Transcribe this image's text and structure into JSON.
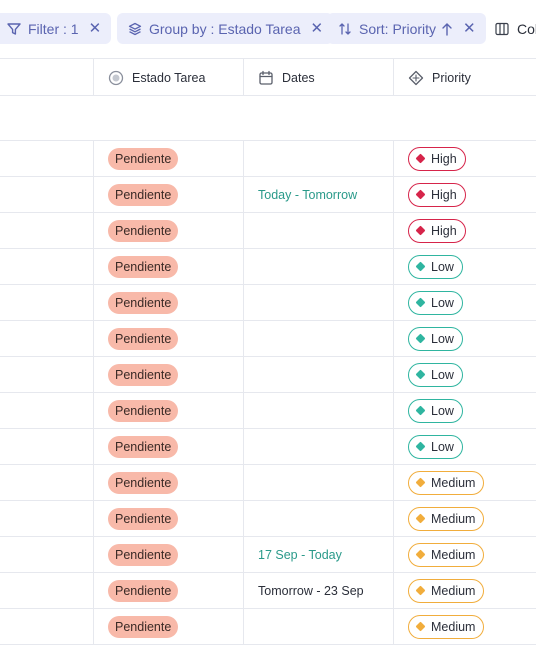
{
  "toolbar": {
    "filter_label": "Filter : 1",
    "group_label": "Group by : Estado Tarea",
    "sort_label": "Sort: Priority",
    "columns_label": "Col"
  },
  "columns": {
    "estado": "Estado Tarea",
    "dates": "Dates",
    "priority": "Priority"
  },
  "colors": {
    "high": "#d6244a",
    "low": "#2fb5a0",
    "medium": "#f1ad3c",
    "status_bg": "#f8b9a9",
    "chip_bg": "#eceefb"
  },
  "rows": [
    {
      "status": "Pendiente",
      "dates": "",
      "dates_style": "teal",
      "priority": "High",
      "level": "high"
    },
    {
      "status": "Pendiente",
      "dates": "Today - Tomorrow",
      "dates_style": "teal",
      "priority": "High",
      "level": "high"
    },
    {
      "status": "Pendiente",
      "dates": "",
      "dates_style": "teal",
      "priority": "High",
      "level": "high"
    },
    {
      "status": "Pendiente",
      "dates": "",
      "dates_style": "teal",
      "priority": "Low",
      "level": "low"
    },
    {
      "status": "Pendiente",
      "dates": "",
      "dates_style": "teal",
      "priority": "Low",
      "level": "low"
    },
    {
      "status": "Pendiente",
      "dates": "",
      "dates_style": "teal",
      "priority": "Low",
      "level": "low"
    },
    {
      "status": "Pendiente",
      "dates": "",
      "dates_style": "teal",
      "priority": "Low",
      "level": "low"
    },
    {
      "status": "Pendiente",
      "dates": "",
      "dates_style": "teal",
      "priority": "Low",
      "level": "low"
    },
    {
      "status": "Pendiente",
      "dates": "",
      "dates_style": "teal",
      "priority": "Low",
      "level": "low"
    },
    {
      "status": "Pendiente",
      "dates": "",
      "dates_style": "teal",
      "priority": "Medium",
      "level": "medium"
    },
    {
      "status": "Pendiente",
      "dates": "",
      "dates_style": "teal",
      "priority": "Medium",
      "level": "medium"
    },
    {
      "status": "Pendiente",
      "dates": "17 Sep - Today",
      "dates_style": "teal",
      "priority": "Medium",
      "level": "medium"
    },
    {
      "status": "Pendiente",
      "dates": "Tomorrow - 23 Sep",
      "dates_style": "dark",
      "priority": "Medium",
      "level": "medium"
    },
    {
      "status": "Pendiente",
      "dates": "",
      "dates_style": "teal",
      "priority": "Medium",
      "level": "medium"
    }
  ]
}
